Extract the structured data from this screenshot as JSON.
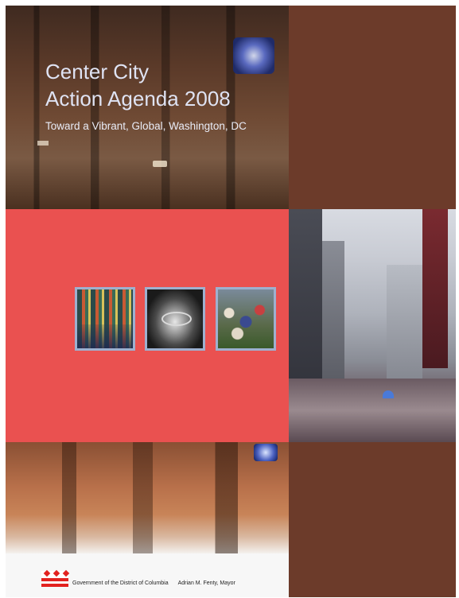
{
  "cover": {
    "title_line1": "Center City",
    "title_line2": "Action Agenda 2008",
    "subtitle": "Toward a Vibrant, Global, Washington, DC",
    "footer_government": "Government of the District of Columbia",
    "footer_mayor": "Adrian M. Fenty, Mayor"
  },
  "colors": {
    "brown": "#6c3b2a",
    "red": "#ea5150",
    "title": "#dfe3f3",
    "thumb_border": "#9eb0cf"
  }
}
